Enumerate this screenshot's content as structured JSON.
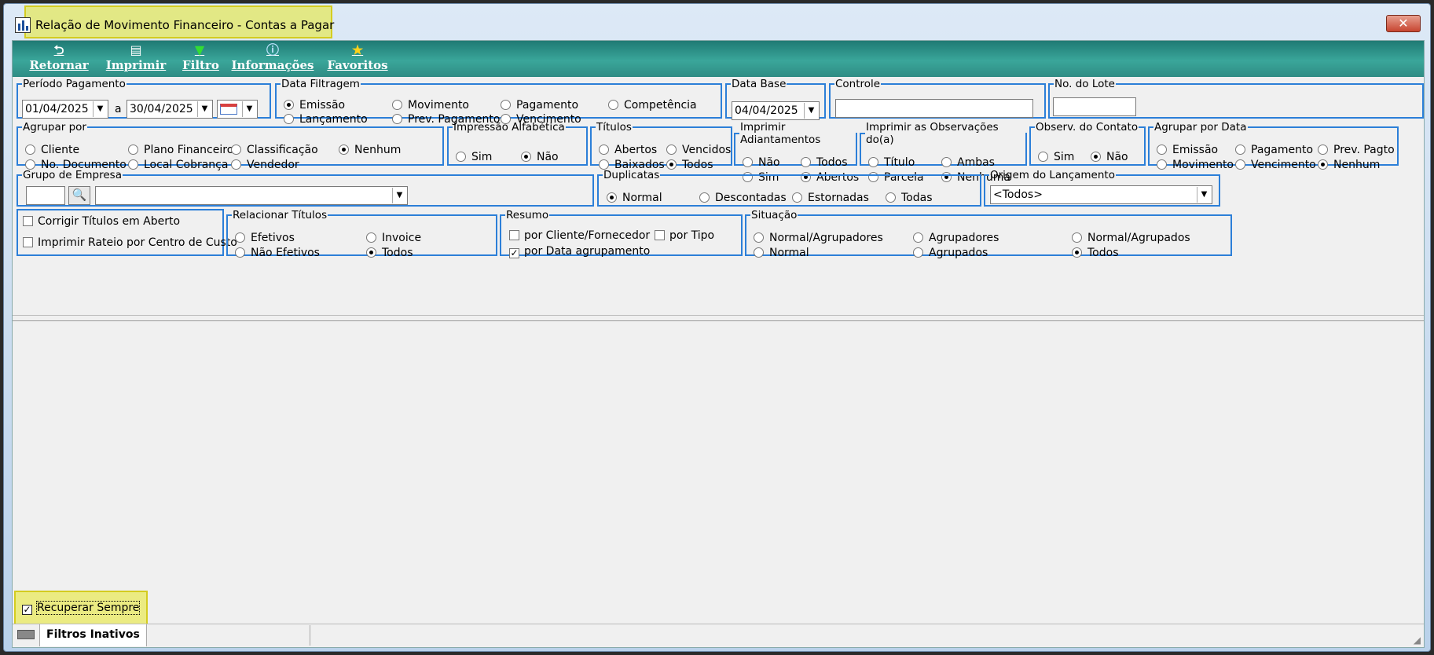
{
  "window": {
    "title": "Relação de Movimento Financeiro - Contas a Pagar",
    "close": "✕"
  },
  "toolbar": [
    {
      "label": "Retornar",
      "icon": "undo-icon"
    },
    {
      "label": "Imprimir",
      "icon": "printer-icon"
    },
    {
      "label": "Filtro",
      "icon": "funnel-icon"
    },
    {
      "label": "Informações",
      "icon": "info-icon"
    },
    {
      "label": "Favoritos",
      "icon": "star-icon"
    }
  ],
  "periodo": {
    "legend": "Período Pagamento",
    "from": "01/04/2025",
    "sep": "a",
    "to": "30/04/2025"
  },
  "data_filtragem": {
    "legend": "Data Filtragem",
    "options": [
      "Emissão",
      "Movimento",
      "Pagamento",
      "Competência",
      "Lançamento",
      "Prev. Pagamento",
      "Vencimento"
    ],
    "selected": "Emissão"
  },
  "data_base": {
    "legend": "Data Base",
    "value": "04/04/2025"
  },
  "controle": {
    "legend": "Controle",
    "value": ""
  },
  "lote": {
    "legend": "No. do Lote",
    "value": ""
  },
  "agrupar": {
    "legend": "Agrupar por",
    "options": [
      "Cliente",
      "Plano Financeiro",
      "Classificação",
      "Nenhum",
      "No. Documento",
      "Local Cobrança",
      "Vendedor"
    ],
    "selected": "Nenhum"
  },
  "impressao_alfa": {
    "legend": "Impressão Alfabética",
    "options": [
      "Sim",
      "Não"
    ],
    "selected": "Não"
  },
  "titulos": {
    "legend": "Títulos",
    "options": [
      "Abertos",
      "Vencidos",
      "Baixados",
      "Todos"
    ],
    "selected": "Todos"
  },
  "adiantamentos": {
    "legend": "Imprimir Adiantamentos",
    "options": [
      "Não",
      "Todos",
      "Sim",
      "Abertos"
    ],
    "selected": "Abertos"
  },
  "observacoes": {
    "legend": "Imprimir as Observações do(a)",
    "options": [
      "Título",
      "Ambas",
      "Parcela",
      "Nenhuma"
    ],
    "selected": "Nenhuma"
  },
  "observ_contato": {
    "legend": "Observ.  do Contato",
    "options": [
      "Sim",
      "Não"
    ],
    "selected": "Não"
  },
  "agrupar_data": {
    "legend": "Agrupar por Data",
    "options": [
      "Emissão",
      "Pagamento",
      "Prev. Pagto",
      "Movimento",
      "Vencimento",
      "Nenhum"
    ],
    "selected": "Nenhum"
  },
  "grupo_empresa": {
    "legend": "Grupo de Empresa",
    "code": "",
    "name": ""
  },
  "duplicatas": {
    "legend": "Duplicatas",
    "options": [
      "Normal",
      "Descontadas",
      "Estornadas",
      "Todas"
    ],
    "selected": "Normal"
  },
  "origem": {
    "legend": "Origem do Lançamento",
    "value": "<Todos>"
  },
  "opcoes": {
    "corrigir": "Corrigir Títulos em Aberto",
    "rateio": "Imprimir Rateio por Centro de Custo"
  },
  "relacionar": {
    "legend": "Relacionar Títulos",
    "options": [
      "Efetivos",
      "Invoice",
      "Não Efetivos",
      "Todos"
    ],
    "selected": "Todos"
  },
  "resumo": {
    "legend": "Resumo",
    "cliente": "por Cliente/Fornecedor",
    "tipo": "por Tipo",
    "data": "por Data agrupamento"
  },
  "situacao": {
    "legend": "Situação",
    "options": [
      "Normal/Agrupadores",
      "Agrupadores",
      "Normal/Agrupados",
      "Normal",
      "Agrupados",
      "Todos"
    ],
    "selected": "Todos"
  },
  "footer": {
    "recuperar": "Recuperar Sempre",
    "tab": "Filtros Inativos"
  }
}
